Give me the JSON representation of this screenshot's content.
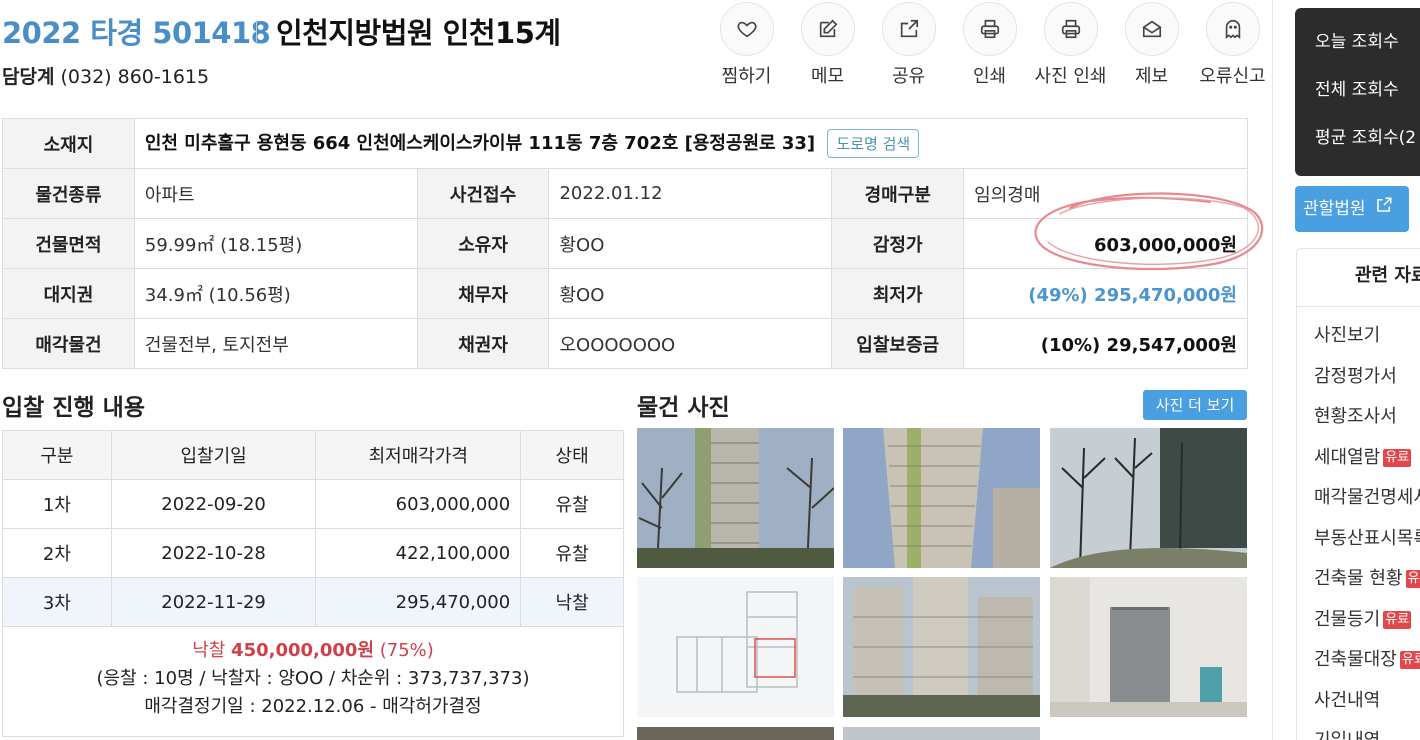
{
  "header": {
    "case_number": "2022 타경 501418",
    "court": "인천지방법원 인천15계",
    "contact_label": "담당계",
    "contact_phone": "(032) 860-1615"
  },
  "toolbar": [
    {
      "label": "찜하기",
      "icon": "heart-icon"
    },
    {
      "label": "메모",
      "icon": "memo-edit-icon"
    },
    {
      "label": "공유",
      "icon": "share-icon"
    },
    {
      "label": "인쇄",
      "icon": "printer-icon"
    },
    {
      "label": "사진 인쇄",
      "icon": "photo-printer-icon"
    },
    {
      "label": "제보",
      "icon": "envelope-icon"
    },
    {
      "label": "오류신고",
      "icon": "ghost-icon"
    }
  ],
  "info": {
    "address_label": "소재지",
    "address": "인천 미추홀구 용현동 664 인천에스케이스카이뷰 111동 7층 702호 [용정공원로 33]",
    "road_search_label": "도로명 검색",
    "rows": [
      [
        {
          "label": "물건종류",
          "value": "아파트"
        },
        {
          "label": "사건접수",
          "value": "2022.01.12"
        },
        {
          "label": "경매구분",
          "value": "임의경매"
        }
      ],
      [
        {
          "label": "건물면적",
          "value": "59.99㎡ (18.15평)"
        },
        {
          "label": "소유자",
          "value": "황OO"
        },
        {
          "label": "감정가",
          "value": "603,000,000원"
        }
      ],
      [
        {
          "label": "대지권",
          "value": "34.9㎡ (10.56평)"
        },
        {
          "label": "채무자",
          "value": "황OO"
        },
        {
          "label": "최저가",
          "value": "(49%) 295,470,000원"
        }
      ],
      [
        {
          "label": "매각물건",
          "value": "건물전부, 토지전부"
        },
        {
          "label": "채권자",
          "value": "오OOOOOOO"
        },
        {
          "label": "입찰보증금",
          "value": "(10%) 29,547,000원"
        }
      ]
    ],
    "accent_color": "#4a95d0"
  },
  "bid_section": {
    "title": "입찰 진행 내용",
    "headers": [
      "구분",
      "입찰기일",
      "최저매각가격",
      "상태"
    ],
    "rows": [
      {
        "round": "1차",
        "date": "2022-09-20",
        "price": "603,000,000",
        "status": "유찰"
      },
      {
        "round": "2차",
        "date": "2022-10-28",
        "price": "422,100,000",
        "status": "유찰"
      },
      {
        "round": "3차",
        "date": "2022-11-29",
        "price": "295,470,000",
        "status": "낙찰"
      }
    ],
    "result_label": "낙찰",
    "result_amount": "450,000,000원",
    "result_ratio": "(75%)",
    "result_detail": "(응찰 : 10명 / 낙찰자 : 양OO / 차순위 : 373,737,373)",
    "decision": "매각결정기일 : 2022.12.06 - 매각허가결정"
  },
  "photos": {
    "title": "물건 사진",
    "more_label": "사진 더 보기"
  },
  "sidebar": {
    "stats": [
      "오늘 조회수",
      "전체 조회수",
      "평균 조회수(2"
    ],
    "court_button": "관할법원",
    "related_title": "관련 자료",
    "paid_badge": "유료",
    "items": [
      {
        "label": "사진보기",
        "paid": false
      },
      {
        "label": "감정평가서",
        "paid": false
      },
      {
        "label": "현황조사서",
        "paid": false
      },
      {
        "label": "세대열람",
        "paid": true
      },
      {
        "label": "매각물건명세서",
        "paid": false
      },
      {
        "label": "부동산표시목록",
        "paid": false
      },
      {
        "label": "건축물 현황",
        "paid": true
      },
      {
        "label": "건물등기",
        "paid": true
      },
      {
        "label": "건축물대장",
        "paid": true
      },
      {
        "label": "사건내역",
        "paid": false
      },
      {
        "label": "기일내역",
        "paid": false
      }
    ]
  }
}
